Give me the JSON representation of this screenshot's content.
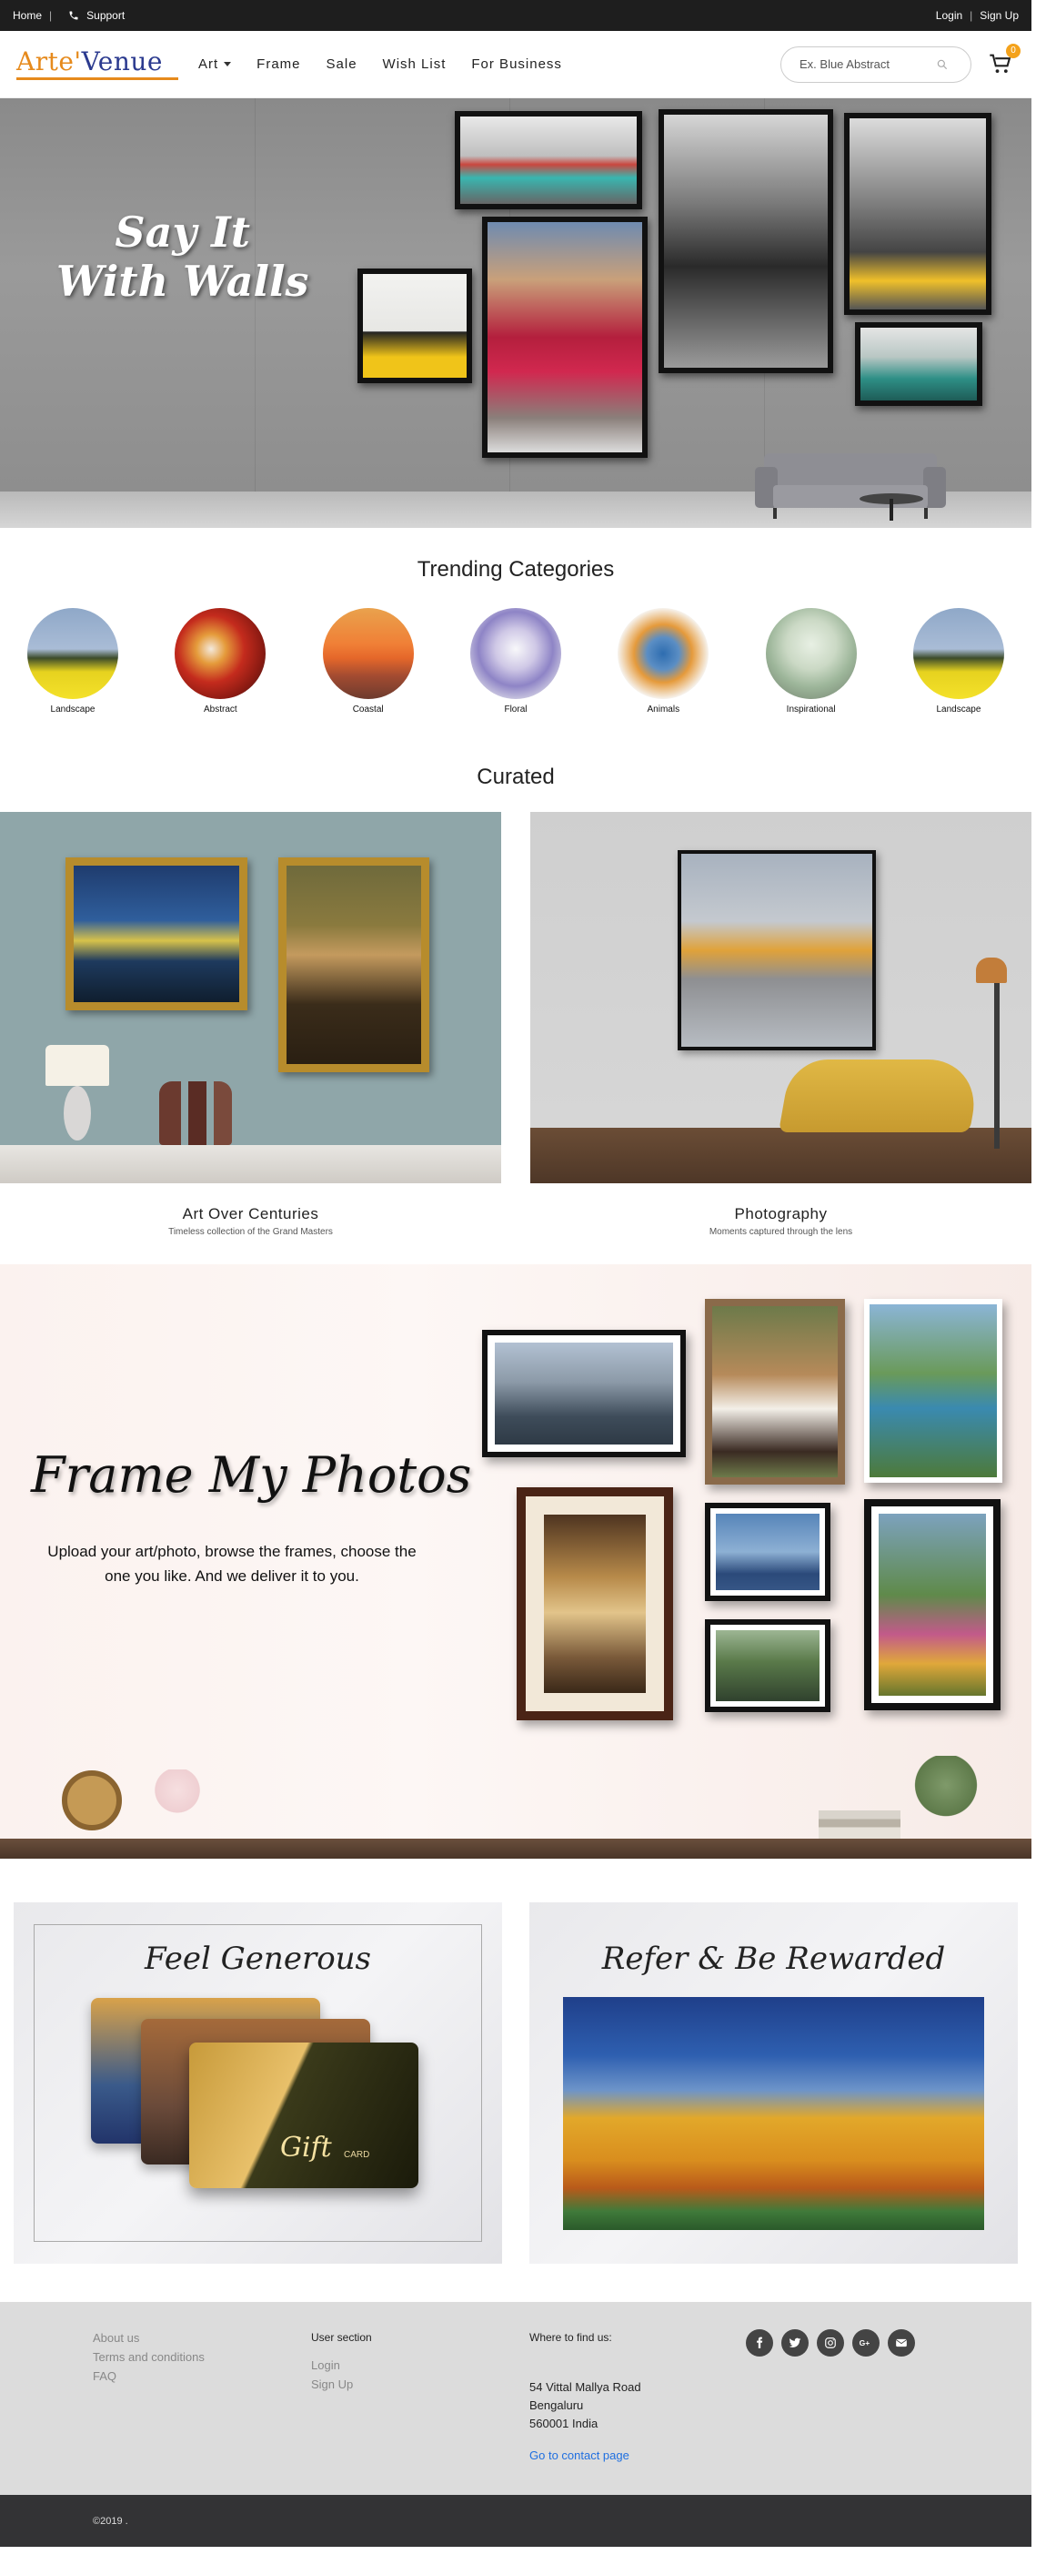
{
  "topbar": {
    "home": "Home",
    "support": "Support",
    "login": "Login",
    "signup": "Sign Up"
  },
  "header": {
    "logo_arte": "Arte'",
    "logo_venue": "Venue",
    "nav": [
      {
        "label": "Art",
        "icon": "chevron-down-icon"
      },
      {
        "label": "Frame"
      },
      {
        "label": "Sale"
      },
      {
        "label": "Wish List"
      },
      {
        "label": "For Business"
      }
    ],
    "search_placeholder": "Ex. Blue Abstract",
    "cart_count": "0"
  },
  "hero": {
    "line1": "Say It",
    "line2": "With Walls"
  },
  "trending": {
    "title": "Trending Categories",
    "categories": [
      {
        "label": "Landscape"
      },
      {
        "label": "Abstract"
      },
      {
        "label": "Coastal"
      },
      {
        "label": "Floral"
      },
      {
        "label": "Animals"
      },
      {
        "label": "Inspirational"
      },
      {
        "label": "Landscape"
      }
    ]
  },
  "curated": {
    "title": "Curated",
    "cards": [
      {
        "title": "Art Over Centuries",
        "subtitle": "Timeless collection of the Grand Masters"
      },
      {
        "title": "Photography",
        "subtitle": "Moments captured through the lens"
      }
    ]
  },
  "frame_my_photos": {
    "title": "Frame My Photos",
    "text": "Upload your art/photo, browse the frames, choose the one you like. And we deliver it to you."
  },
  "promos": {
    "gift": {
      "title": "Feel Generous",
      "card_text": "Gift",
      "card_sub": "CARD"
    },
    "refer": {
      "title": "Refer & Be Rewarded"
    }
  },
  "footer": {
    "links": [
      "About us",
      "Terms and conditions",
      "FAQ"
    ],
    "user_section_title": "User section",
    "user_links": [
      "Login",
      "Sign Up"
    ],
    "find_us_title": "Where to find us:",
    "address": [
      "54 Vittal Mallya Road",
      "Bengaluru",
      "560001  India"
    ],
    "contact_link": "Go to contact page",
    "socials": [
      "facebook-icon",
      "twitter-icon",
      "instagram-icon",
      "google-plus-icon",
      "email-icon"
    ],
    "copyright": "©2019 ."
  }
}
